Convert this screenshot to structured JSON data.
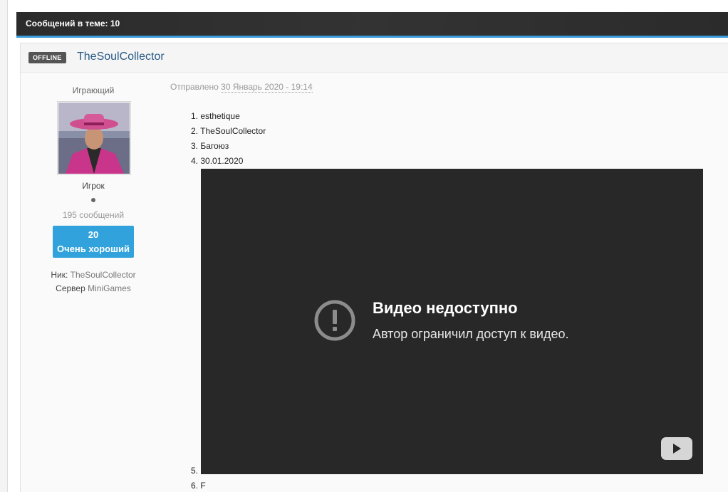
{
  "topic_header": {
    "title": "Сообщений в теме: 10"
  },
  "post": {
    "status_badge": "OFFLINE",
    "author": "TheSoulCollector",
    "rank_title": "Играющий",
    "group": "Игрок",
    "post_count": "195 сообщений",
    "reputation": {
      "value": "20",
      "label": "Очень хороший"
    },
    "nick_label": "Ник:",
    "nick_value": "TheSoulCollector",
    "server_label": "Сервер",
    "server_value": "MiniGames",
    "date_prefix": "Отправлено",
    "date": "30 Январь 2020 - 19:14",
    "list_items": [
      {
        "num": "1.",
        "text": "esthetique"
      },
      {
        "num": "2.",
        "text": "TheSoulCollector"
      },
      {
        "num": "3.",
        "text": "Багоюз"
      },
      {
        "num": "4.",
        "text": "30.01.2020"
      },
      {
        "num": "5.",
        "text": ""
      },
      {
        "num": "6.",
        "text": "F"
      }
    ],
    "video": {
      "title": "Видео недоступно",
      "message": "Автор ограничил доступ к видео.",
      "icon": "alert-circle-icon",
      "play_icon": "youtube-play-icon"
    }
  },
  "colors": {
    "header_bg": "#2d2d2d",
    "header_accent": "#3b9ad9",
    "reputation_bg": "#31a2dc",
    "author_link": "#2a5a86",
    "video_bg": "#282828"
  }
}
